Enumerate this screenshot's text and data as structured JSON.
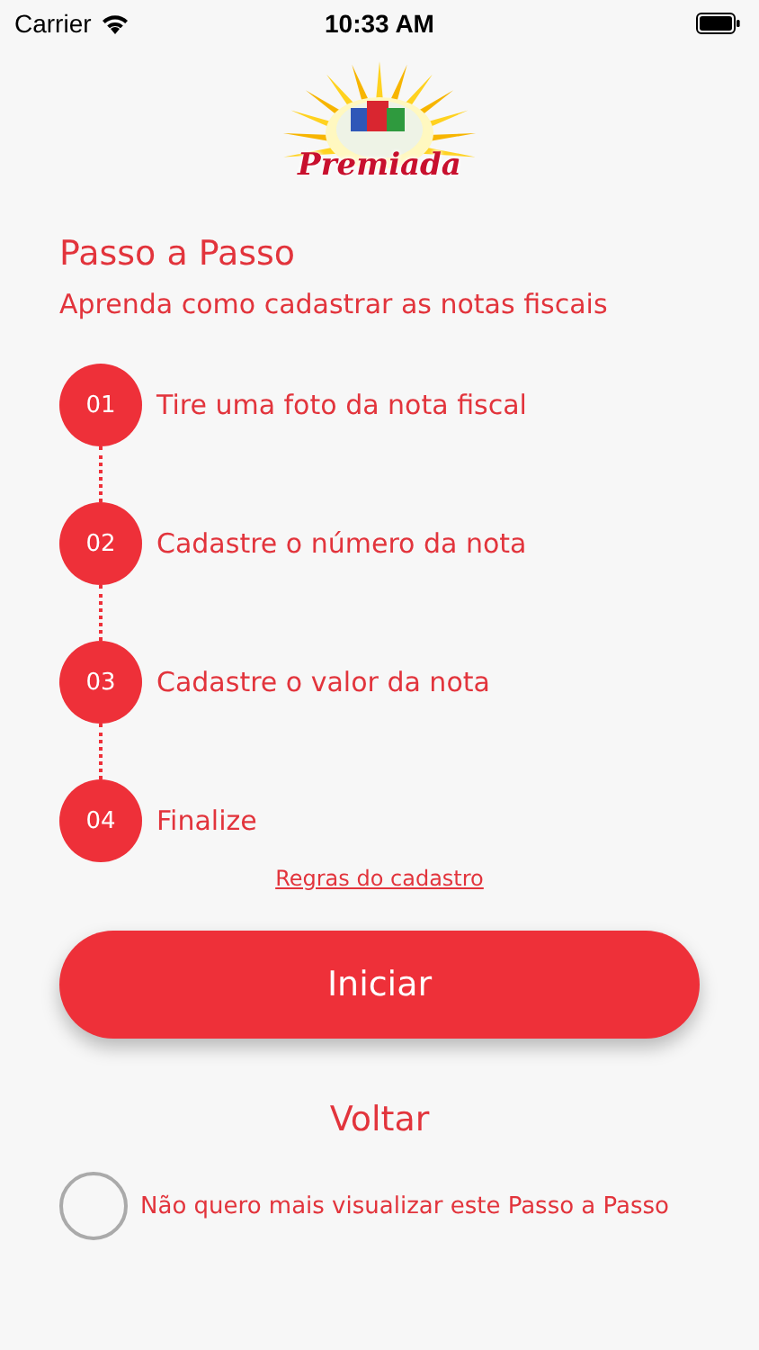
{
  "status_bar": {
    "carrier": "Carrier",
    "time": "10:33 AM"
  },
  "logo": {
    "text": "Premiada"
  },
  "header": {
    "title": "Passo a Passo",
    "subtitle": "Aprenda como cadastrar as notas fiscais"
  },
  "steps": [
    {
      "number": "01",
      "label": "Tire uma foto da nota fiscal"
    },
    {
      "number": "02",
      "label": "Cadastre o número da nota"
    },
    {
      "number": "03",
      "label": "Cadastre o valor da nota"
    },
    {
      "number": "04",
      "label": "Finalize"
    }
  ],
  "rules_link": "Regras do cadastro",
  "start_button": "Iniciar",
  "back_button": "Voltar",
  "dont_show_again": {
    "label": "Não quero mais visualizar este Passo a Passo",
    "checked": false
  }
}
